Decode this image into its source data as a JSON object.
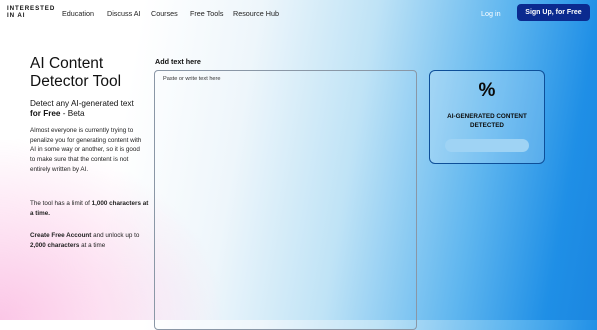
{
  "nav": {
    "logo_line1": "INTERESTED",
    "logo_line2": "IN AI",
    "links": [
      "Education",
      "Discuss AI",
      "Courses",
      "Free Tools",
      "Resource Hub"
    ],
    "login": "Log in",
    "signup": "Sign Up, for Free"
  },
  "left": {
    "title": "AI Content Detector Tool",
    "subtitle_a": "Detect any AI-generated text",
    "subtitle_b": "for Free",
    "subtitle_c": " - Beta",
    "desc": "Almost everyone is currently trying to penalize you for generating content with AI in some way or another, so it is good to make sure that the content is not entirely written by AI.",
    "limit_a": "The tool has a limit of ",
    "limit_b": "1,000 characters at a time.",
    "account_a": "Create Free Account",
    "account_b": " and unlock up to ",
    "account_c": "2,000 characters",
    "account_d": " at a time"
  },
  "editor": {
    "label": "Add text here",
    "placeholder": "Paste or write text here"
  },
  "result": {
    "percent": "%",
    "detected": "AI-GENERATED CONTENT DETECTED"
  }
}
